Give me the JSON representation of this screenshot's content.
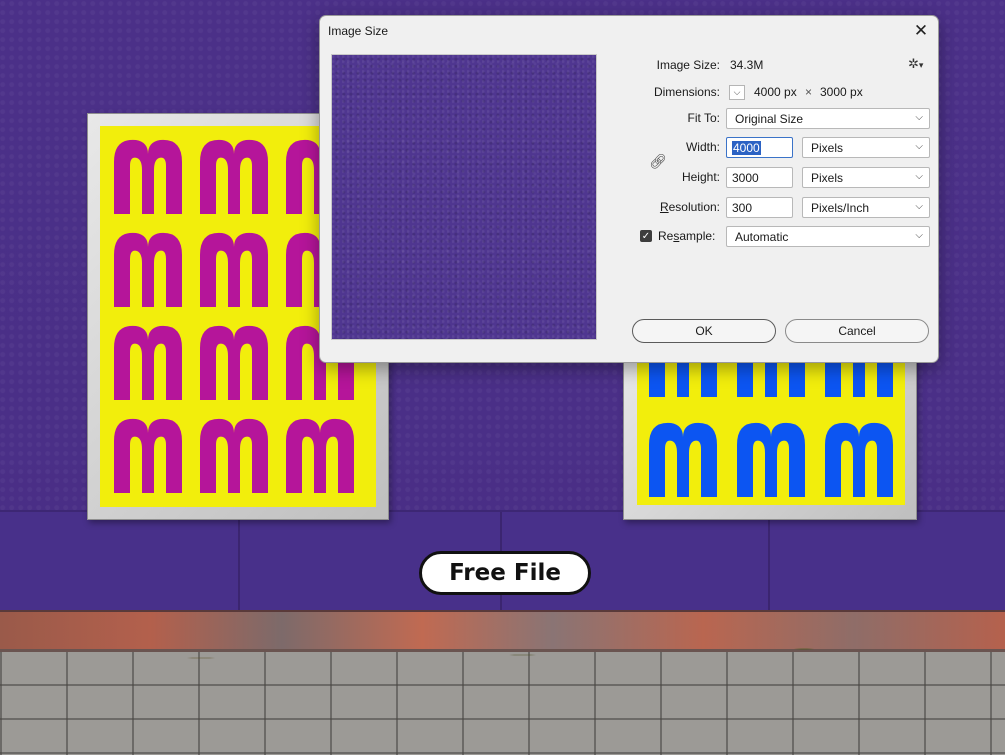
{
  "background": {
    "pill_label": "Free File",
    "poster_letter": "M",
    "colors": {
      "wall": "#4a2f87",
      "poster_yellow": "#f2ee0c",
      "letter_magenta": "#b5159a",
      "letter_blue": "#0c55f2"
    }
  },
  "dialog": {
    "title": "Image Size",
    "close_icon": "close-icon",
    "image_size_label": "Image Size:",
    "image_size_value": "34.3M",
    "settings_icon": "gear-icon",
    "dimensions_label": "Dimensions:",
    "dim_width": "4000 px",
    "dim_times": "×",
    "dim_height": "3000 px",
    "fit_to_label": "Fit To:",
    "fit_to_value": "Original Size",
    "width_label": "Width:",
    "width_value": "4000",
    "width_unit": "Pixels",
    "height_label": "Height:",
    "height_value": "3000",
    "height_unit": "Pixels",
    "resolution_label_first": "R",
    "resolution_label_rest": "esolution:",
    "resolution_value": "300",
    "resolution_unit": "Pixels/Inch",
    "resample_label_first": "Re",
    "resample_label_u": "s",
    "resample_label_rest": "ample:",
    "resample_checked": true,
    "resample_value": "Automatic",
    "ok_label": "OK",
    "cancel_label": "Cancel"
  }
}
